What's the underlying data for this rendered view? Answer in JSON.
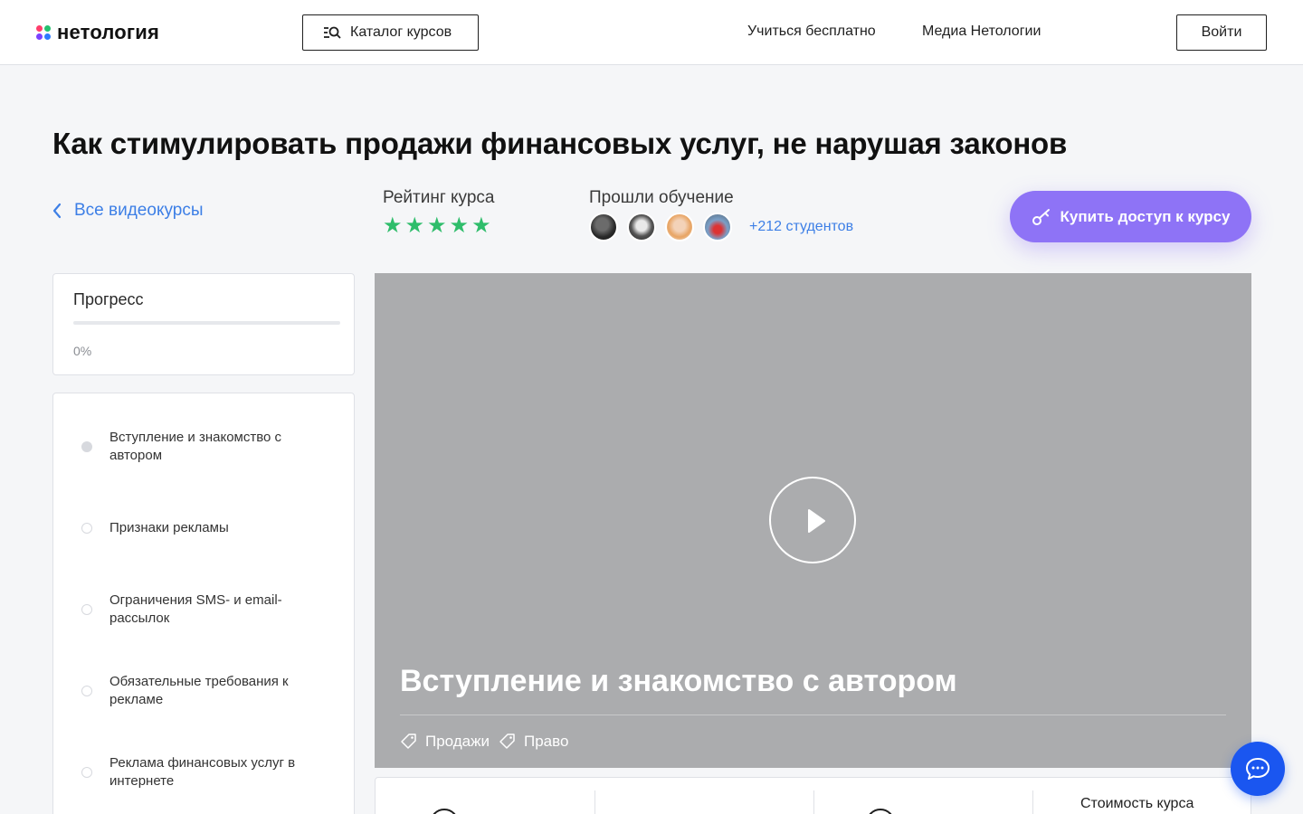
{
  "header": {
    "logo_text": "нетология",
    "catalog_label": "Каталог курсов",
    "nav": [
      "Учиться бесплатно",
      "Медиа Нетологии"
    ],
    "login_label": "Войти"
  },
  "course": {
    "title": "Как стимулировать продажи финансовых услуг, не нарушая законов",
    "back_label": "Все видеокурсы",
    "rating_label": "Рейтинг курса",
    "rating_stars": 5,
    "passed_label": "Прошли обучение",
    "students_label": "+212 студентов",
    "buy_label": "Купить доступ к курсу"
  },
  "progress": {
    "title": "Прогресс",
    "percent_label": "0%",
    "fraction": 0
  },
  "lessons": [
    {
      "title": "Вступление и знакомство с автором",
      "active": true
    },
    {
      "title": "Признаки рекламы",
      "active": false
    },
    {
      "title": "Ограничения SMS- и email-рассылок",
      "active": false
    },
    {
      "title": "Обязательные требования к рекламе",
      "active": false
    },
    {
      "title": "Реклама финансовых услуг в интернете",
      "active": false
    }
  ],
  "video": {
    "title": "Вступление и знакомство с автором",
    "tags": [
      "Продажи",
      "Право"
    ]
  },
  "info": {
    "price_label": "Стоимость курса"
  },
  "colors": {
    "accent_blue": "#3d7fe6",
    "buy_purple": "#8e73f6",
    "star_green": "#2fbd6b",
    "chat_blue": "#1a56f0",
    "video_bg": "#abacae"
  },
  "icons": {
    "catalog": "catalog-search-icon",
    "back": "chevron-left-icon",
    "buy": "key-icon",
    "play": "play-icon",
    "tag": "tag-icon",
    "chat": "chat-bubble-icon"
  }
}
